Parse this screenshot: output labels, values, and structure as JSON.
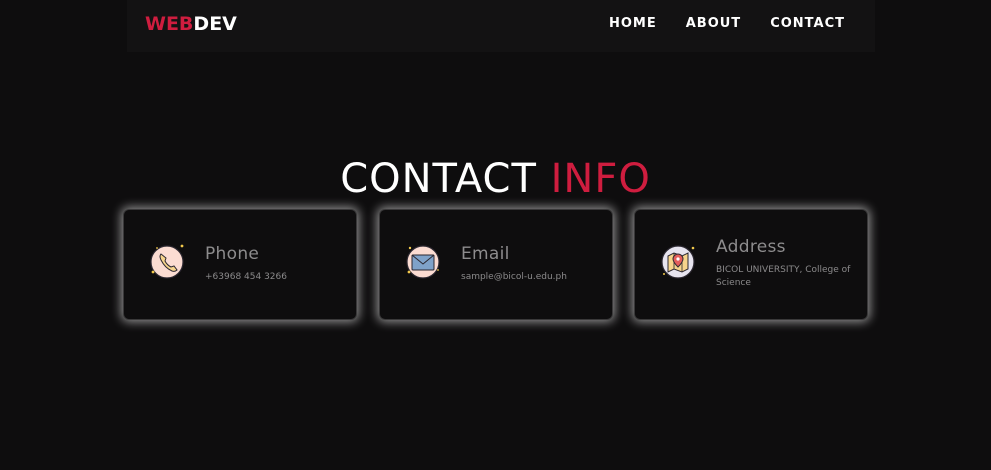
{
  "brand": {
    "part1": "WEB",
    "part2": "DEV"
  },
  "nav": {
    "items": [
      "HOME",
      "ABOUT",
      "CONTACT"
    ]
  },
  "heading": {
    "main": "CONTACT",
    "accent": "INFO"
  },
  "cards": [
    {
      "title": "Phone",
      "text": "+63968 454 3266",
      "icon": "phone-icon"
    },
    {
      "title": "Email",
      "text": "sample@bicol-u.edu.ph",
      "icon": "envelope-icon"
    },
    {
      "title": "Address",
      "text": "BICOL UNIVERSITY, College of Science",
      "icon": "map-pin-icon"
    }
  ],
  "colors": {
    "background": "#0e0d0e",
    "navbar": "#131213",
    "accent": "#cf1d3f"
  }
}
